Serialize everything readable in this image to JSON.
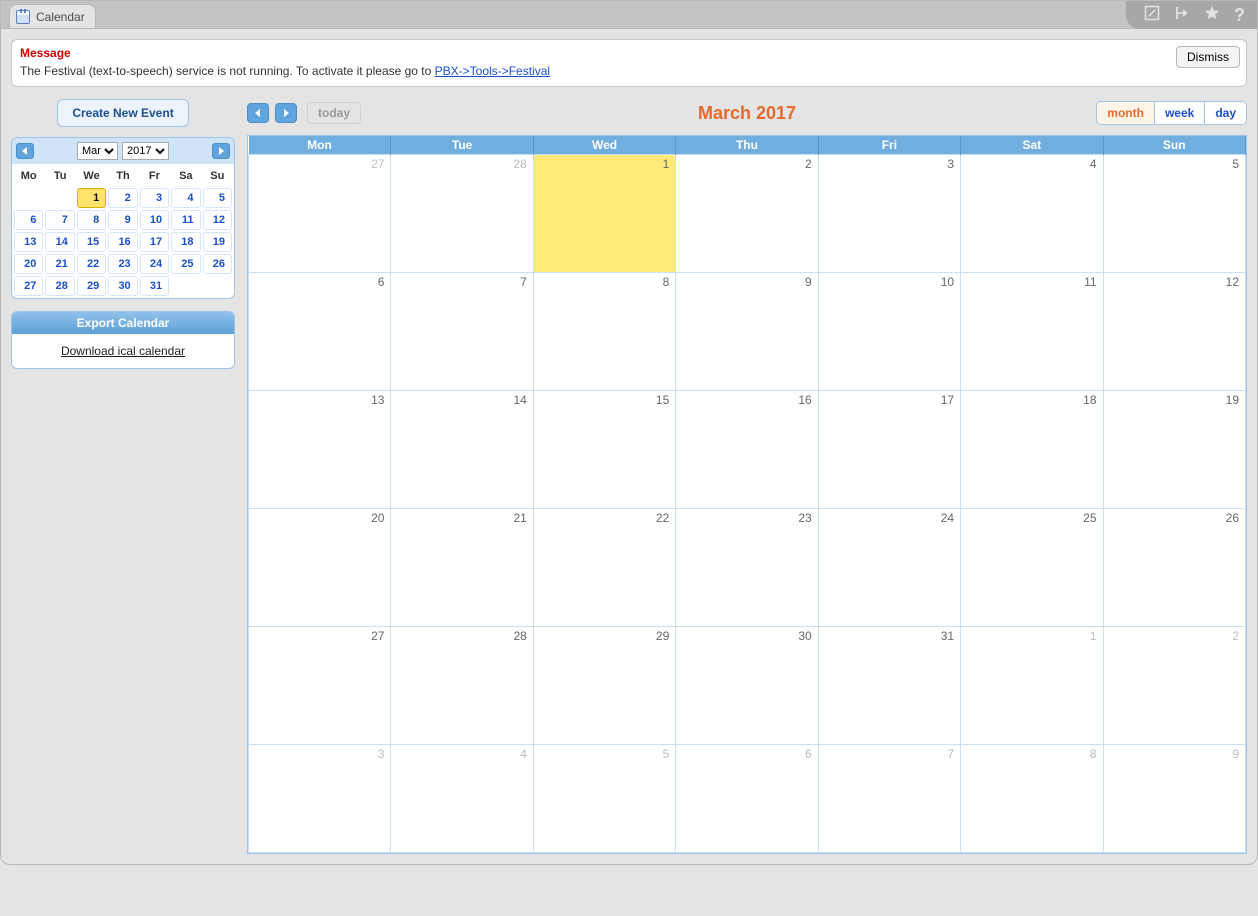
{
  "tab": {
    "title": "Calendar"
  },
  "topicons": {
    "edit": "edit-icon",
    "export": "export-icon",
    "star": "star-icon",
    "help": "help-icon"
  },
  "message": {
    "title": "Message",
    "text_before_link": "The Festival (text-to-speech) service is not running. To activate it please go to ",
    "link_text": "PBX->Tools->Festival",
    "dismiss": "Dismiss"
  },
  "sidebar": {
    "create_btn": "Create New Event",
    "mini": {
      "month_selected": "Mar",
      "year_selected": "2017",
      "dow": [
        "Mo",
        "Tu",
        "We",
        "Th",
        "Fr",
        "Sa",
        "Su"
      ],
      "weeks": [
        [
          "",
          "",
          "1",
          "2",
          "3",
          "4",
          "5"
        ],
        [
          "6",
          "7",
          "8",
          "9",
          "10",
          "11",
          "12"
        ],
        [
          "13",
          "14",
          "15",
          "16",
          "17",
          "18",
          "19"
        ],
        [
          "20",
          "21",
          "22",
          "23",
          "24",
          "25",
          "26"
        ],
        [
          "27",
          "28",
          "29",
          "30",
          "31",
          "",
          ""
        ]
      ],
      "today": "1"
    },
    "export": {
      "title": "Export Calendar",
      "link": "Download ical calendar"
    }
  },
  "main": {
    "today_btn": "today",
    "title": "March 2017",
    "views": {
      "month": "month",
      "week": "week",
      "day": "day",
      "active": "month"
    },
    "dow": [
      "Mon",
      "Tue",
      "Wed",
      "Thu",
      "Fri",
      "Sat",
      "Sun"
    ],
    "weeks": [
      [
        {
          "n": "27",
          "other": true
        },
        {
          "n": "28",
          "other": true
        },
        {
          "n": "1",
          "today": true
        },
        {
          "n": "2"
        },
        {
          "n": "3"
        },
        {
          "n": "4"
        },
        {
          "n": "5"
        }
      ],
      [
        {
          "n": "6"
        },
        {
          "n": "7"
        },
        {
          "n": "8"
        },
        {
          "n": "9"
        },
        {
          "n": "10"
        },
        {
          "n": "11"
        },
        {
          "n": "12"
        }
      ],
      [
        {
          "n": "13"
        },
        {
          "n": "14"
        },
        {
          "n": "15"
        },
        {
          "n": "16"
        },
        {
          "n": "17"
        },
        {
          "n": "18"
        },
        {
          "n": "19"
        }
      ],
      [
        {
          "n": "20"
        },
        {
          "n": "21"
        },
        {
          "n": "22"
        },
        {
          "n": "23"
        },
        {
          "n": "24"
        },
        {
          "n": "25"
        },
        {
          "n": "26"
        }
      ],
      [
        {
          "n": "27"
        },
        {
          "n": "28"
        },
        {
          "n": "29"
        },
        {
          "n": "30"
        },
        {
          "n": "31"
        },
        {
          "n": "1",
          "other": true
        },
        {
          "n": "2",
          "other": true
        }
      ],
      [
        {
          "n": "3",
          "other": true
        },
        {
          "n": "4",
          "other": true
        },
        {
          "n": "5",
          "other": true
        },
        {
          "n": "6",
          "other": true
        },
        {
          "n": "7",
          "other": true
        },
        {
          "n": "8",
          "other": true
        },
        {
          "n": "9",
          "other": true
        }
      ]
    ]
  }
}
